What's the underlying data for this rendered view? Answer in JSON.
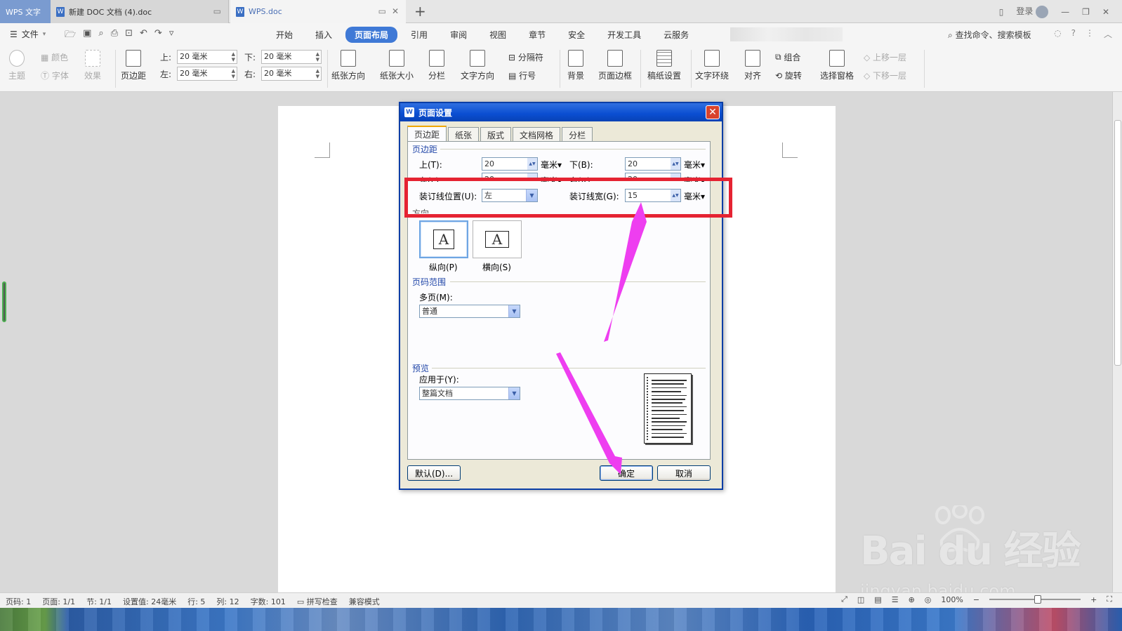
{
  "titlebar": {
    "app_tab": "WPS 文字",
    "doc_tab_1": "新建 DOC 文档 (4).doc",
    "doc_tab_2": "WPS.doc",
    "login": "登录"
  },
  "menubar": {
    "file": "文件",
    "tabs": [
      "开始",
      "插入",
      "页面布局",
      "引用",
      "审阅",
      "视图",
      "章节",
      "安全",
      "开发工具",
      "云服务"
    ],
    "active_tab": "页面布局",
    "search_placeholder": "查找命令、搜索模板"
  },
  "ribbon": {
    "theme": "主题",
    "colors": "颜色",
    "fonts": "字体",
    "effects": "效果",
    "margins": "页边距",
    "top_label": "上:",
    "top_value": "20 毫米",
    "bottom_label": "下:",
    "bottom_value": "20 毫米",
    "left_label": "左:",
    "left_value": "20 毫米",
    "right_label": "右:",
    "right_value": "20 毫米",
    "orientation": "纸张方向",
    "size": "纸张大小",
    "columns": "分栏",
    "text_direction": "文字方向",
    "breaks": "分隔符",
    "line_numbers": "行号",
    "background": "背景",
    "page_border": "页面边框",
    "manuscript": "稿纸设置",
    "wrap_text": "文字环绕",
    "align": "对齐",
    "group": "组合",
    "rotate": "旋转",
    "selection_pane": "选择窗格",
    "bring_forward": "上移一层",
    "send_backward": "下移一层"
  },
  "dialog": {
    "title": "页面设置",
    "tabs": [
      "页边距",
      "纸张",
      "版式",
      "文档网格",
      "分栏"
    ],
    "active_tab": "页边距",
    "margins_group": "页边距",
    "top_label": "上(T):",
    "top_value": "20",
    "bottom_label": "下(B):",
    "bottom_value": "20",
    "left_label": "左(L):",
    "left_value": "20",
    "right_label": "右(R):",
    "right_value": "20",
    "unit": "毫米",
    "gutter_pos_label": "装订线位置(U):",
    "gutter_pos_value": "左",
    "gutter_width_label": "装订线宽(G):",
    "gutter_width_value": "15",
    "orientation_group": "方向",
    "portrait_label": "纵向(P)",
    "landscape_label": "横向(S)",
    "glyph": "A",
    "page_range_group": "页码范围",
    "multiple_pages_label": "多页(M):",
    "multiple_pages_value": "普通",
    "preview_group": "预览",
    "apply_to_label": "应用于(Y):",
    "apply_to_value": "整篇文档",
    "default_button": "默认(D)...",
    "ok_button": "确定",
    "cancel_button": "取消"
  },
  "statusbar": {
    "page_num": "页码: 1",
    "pages": "页面: 1/1",
    "section": "节: 1/1",
    "setting": "设置值: 24毫米",
    "row": "行: 5",
    "col": "列: 12",
    "words": "字数: 101",
    "spell_check": "拼写检查",
    "compat": "兼容模式",
    "zoom": "100%"
  },
  "watermark": {
    "logo": "Bai du 经验",
    "url": "jingyan.baidu.com"
  },
  "colors": {
    "accent": "#3f79d6",
    "annotation_red": "#e52332",
    "annotation_arrow": "#ee3ef0",
    "dialog_title": "#0a4ed1"
  }
}
